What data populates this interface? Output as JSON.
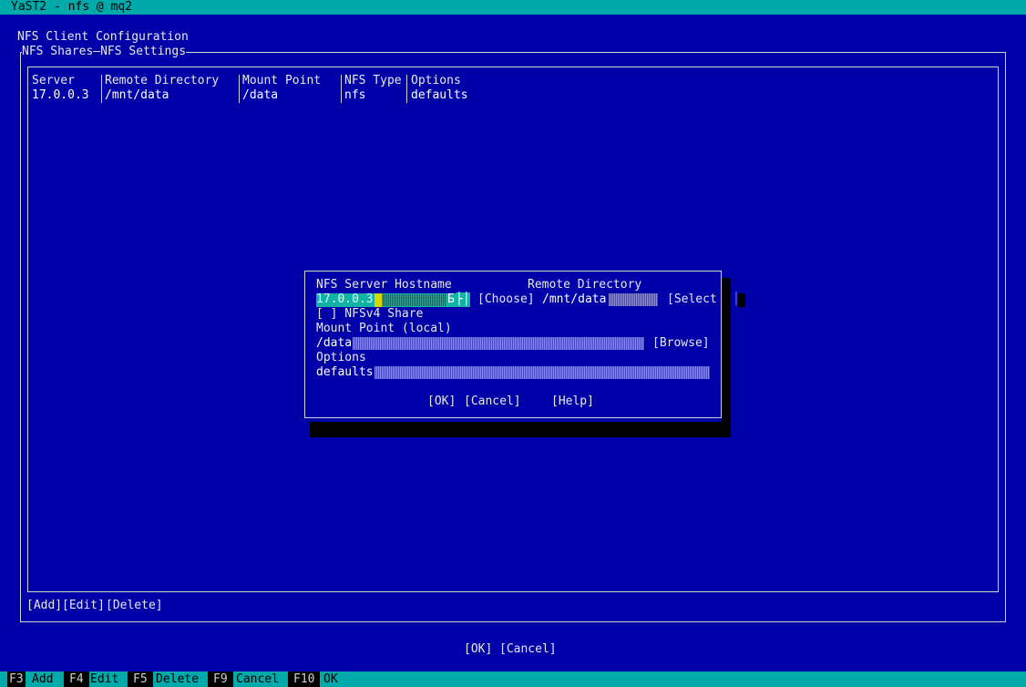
{
  "window": {
    "title": "YaST2 - nfs @ mq2"
  },
  "page": {
    "heading": "NFS Client Configuration"
  },
  "tabs": [
    {
      "label": "NFS Shares"
    },
    {
      "label": "NFS Settings"
    }
  ],
  "tab_separator": "—",
  "table": {
    "columns": [
      "Server",
      "Remote Directory",
      "Mount Point",
      "NFS Type",
      "Options"
    ],
    "rows": [
      [
        "17.0.0.3",
        "/mnt/data",
        "/data",
        "nfs",
        "defaults"
      ]
    ]
  },
  "table_actions": {
    "add": "[Add]",
    "edit": "[Edit]",
    "delete": "[Delete]"
  },
  "dialog": {
    "hostname_label": "NFS Server Hostname",
    "hostname_value": "17.0.0.3",
    "choose_button": "[Choose]",
    "remote_dir_label": "Remote Directory",
    "remote_dir_value": "/mnt/data",
    "select_button": "[Select",
    "nfsv4_checkbox": "[ ] NFSv4 Share",
    "mount_point_label": "Mount Point (local)",
    "mount_point_value": "/data",
    "browse_button": "[Browse]",
    "options_label": "Options",
    "options_value": "defaults",
    "ok_button": "[OK]",
    "cancel_button": "[Cancel]",
    "help_button": "[Help]"
  },
  "main_buttons": {
    "ok": "[OK]",
    "cancel": "[Cancel]"
  },
  "function_keys": [
    {
      "key": "F3",
      "label": "Add"
    },
    {
      "key": "F4",
      "label": "Edit"
    },
    {
      "key": "F5",
      "label": "Delete"
    },
    {
      "key": "F9",
      "label": "Cancel"
    },
    {
      "key": "F10",
      "label": "OK"
    }
  ],
  "colors": {
    "background": "#0000a8",
    "title_bar": "#00aaaa",
    "focus_field": "#13b2a6",
    "cursor": "#d8d800"
  }
}
